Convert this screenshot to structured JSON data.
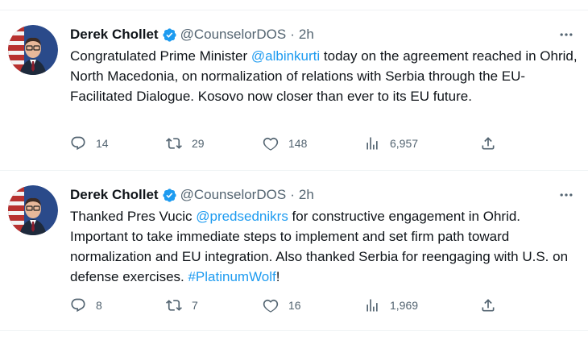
{
  "tweets": [
    {
      "author": "Derek Chollet",
      "handle": "@CounselorDOS",
      "separator": "·",
      "time": "2h",
      "text_parts": [
        {
          "t": "Congratulated Prime Minister ",
          "link": false
        },
        {
          "t": "@albinkurti",
          "link": true
        },
        {
          "t": " today on the agreement reached in Ohrid, North Macedonia, on normalization of relations with Serbia through the EU-Facilitated Dialogue. Kosovo now closer than ever to its EU future.",
          "link": false
        }
      ],
      "replies": "14",
      "retweets": "29",
      "likes": "148",
      "views": "6,957"
    },
    {
      "author": "Derek Chollet",
      "handle": "@CounselorDOS",
      "separator": "·",
      "time": "2h",
      "text_parts": [
        {
          "t": "Thanked Pres Vucic ",
          "link": false
        },
        {
          "t": "@predsednikrs",
          "link": true
        },
        {
          "t": " for constructive engagement in Ohrid. Important to take immediate steps to implement and set firm path toward normalization and EU integration. Also thanked Serbia for reengaging with U.S. on defense exercises. ",
          "link": false
        },
        {
          "t": "#PlatinumWolf",
          "link": true
        },
        {
          "t": "!",
          "link": false
        }
      ],
      "replies": "8",
      "retweets": "7",
      "likes": "16",
      "views": "1,969"
    }
  ],
  "icons": {
    "verified": "verified-badge-icon",
    "more": "more-options-icon",
    "reply": "reply-icon",
    "retweet": "retweet-icon",
    "like": "like-icon",
    "views": "views-icon",
    "share": "share-icon"
  },
  "colors": {
    "text": "#0f1419",
    "secondary": "#536471",
    "link": "#1d9bf0",
    "divider": "#eff3f4"
  }
}
